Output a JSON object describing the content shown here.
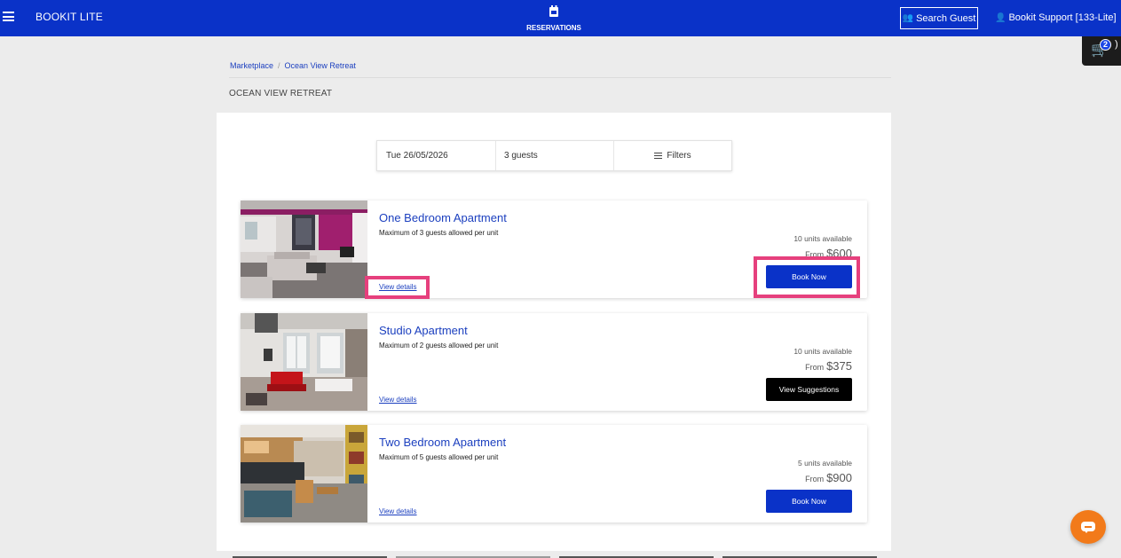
{
  "header": {
    "brand": "BOOKIT LITE",
    "nav_label": "RESERVATIONS",
    "search_guest_label": "Search Guest",
    "user_label": "Bookit Support [133-Lite]"
  },
  "cart": {
    "count": "2",
    "paren": ")"
  },
  "breadcrumb": {
    "items": [
      "Marketplace",
      "Ocean View Retreat"
    ]
  },
  "page_title": "OCEAN VIEW RETREAT",
  "search": {
    "date": "Tue 26/05/2026",
    "guests": "3 guests",
    "filters_label": "Filters"
  },
  "listings": [
    {
      "title": "One Bedroom Apartment",
      "subtitle": "Maximum of 3 guests allowed per unit",
      "details_link": "View details",
      "units": "10 units available",
      "price_prefix": "From",
      "price": "$600",
      "button_label": "Book Now"
    },
    {
      "title": "Studio Apartment",
      "subtitle": "Maximum of 2 guests allowed per unit",
      "details_link": "View details",
      "units": "10 units available",
      "price_prefix": "From",
      "price": "$375",
      "button_label": "View Suggestions"
    },
    {
      "title": "Two Bedroom Apartment",
      "subtitle": "Maximum of 5 guests allowed per unit",
      "details_link": "View details",
      "units": "5 units available",
      "price_prefix": "From",
      "price": "$900",
      "button_label": "Book Now"
    }
  ],
  "colors": {
    "brand_blue": "#0a32c8",
    "highlight": "#e6407d",
    "chat_orange": "#f27a1a"
  }
}
